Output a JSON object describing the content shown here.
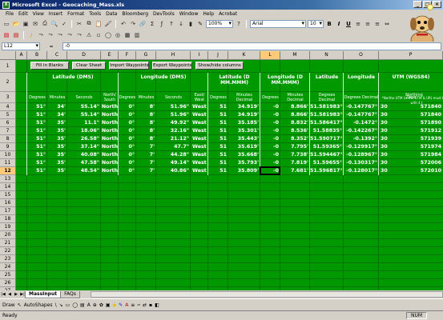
{
  "window": {
    "title": "Microsoft Excel - Geocaching_Mass.xls",
    "minimize": "_",
    "restore": "□",
    "close": "×"
  },
  "menu": [
    "File",
    "Edit",
    "View",
    "Insert",
    "Format",
    "Tools",
    "Data",
    "Bloomberg",
    "DevTools",
    "Window",
    "Help",
    "Acrobat"
  ],
  "toolbar": {
    "zoom": "100%",
    "font": "Arial",
    "size": "10",
    "bold": "B",
    "italic": "I",
    "underline": "U"
  },
  "formula": {
    "cell_ref": "L12",
    "fx": "=",
    "content": "-0"
  },
  "columns": [
    "A",
    "B",
    "C",
    "D",
    "E",
    "F",
    "G",
    "H",
    "I",
    "J",
    "K",
    "L",
    "M",
    "N",
    "O",
    "P"
  ],
  "rows": [
    "1",
    "2",
    "3",
    "4",
    "5",
    "6",
    "7",
    "8",
    "9",
    "10",
    "11",
    "12",
    "13",
    "14",
    "15",
    "16",
    "17",
    "18",
    "19",
    "20",
    "21",
    "22",
    "23",
    "24",
    "25",
    "26",
    "27"
  ],
  "buttons": {
    "fill": "Fill in Blanks",
    "clear": "Clear Sheet",
    "import": "Import Waypoints",
    "export": "Export Waypoints",
    "show": "Show/hide columns"
  },
  "headers": {
    "lat_dms": "Latitude (DMS)",
    "lon_dms": "Longitude (DMS)",
    "lat_dmm": "Latitude (D MM.MMM)",
    "lon_dmm": "Longitude (D MM.MMM)",
    "lat_dd": "Latitude",
    "lon_dd": "Longitude",
    "utm": "UTM (WGS84)",
    "degrees": "Degrees",
    "minutes": "Minutes",
    "seconds": "Seconds",
    "ns": "North/ South",
    "ew": "East/ West",
    "min_dec": "Minutes Decimal",
    "deg_dec": "Degrees Decimal",
    "zone": "Zone",
    "northing": "Northing",
    "northing_note": "*Northe UTM (is the UTM & UR) must begin with 4 t"
  },
  "data_rows": [
    {
      "latd": "51°",
      "latm": "34'",
      "lats": "55.14\"",
      "ns": "North",
      "lond": "0°",
      "lonm": "8'",
      "lons": "51.96\"",
      "ew": "West",
      "dmm_latd": "51",
      "dmm_latm": "34.919'",
      "dmm_lond": "-0",
      "dmm_lonm": "8.866'",
      "dd_lat": "51.581983°",
      "dd_lon": "-0.147767°",
      "zone": "30",
      "north": "571840"
    },
    {
      "latd": "51°",
      "latm": "34'",
      "lats": "55.14\"",
      "ns": "North",
      "lond": "0°",
      "lonm": "8'",
      "lons": "51.96\"",
      "ew": "West",
      "dmm_latd": "51",
      "dmm_latm": "34.919'",
      "dmm_lond": "-0",
      "dmm_lonm": "8.866'",
      "dd_lat": "51.581983°",
      "dd_lon": "-0.147767°",
      "zone": "30",
      "north": "571840"
    },
    {
      "latd": "51°",
      "latm": "35'",
      "lats": "11.1\"",
      "ns": "North",
      "lond": "0°",
      "lonm": "8'",
      "lons": "49.92\"",
      "ew": "West",
      "dmm_latd": "51",
      "dmm_latm": "35.185'",
      "dmm_lond": "-0",
      "dmm_lonm": "8.832'",
      "dd_lat": "51.586417°",
      "dd_lon": "-0.1472°",
      "zone": "30",
      "north": "571890"
    },
    {
      "latd": "51°",
      "latm": "35'",
      "lats": "18.06\"",
      "ns": "North",
      "lond": "0°",
      "lonm": "8'",
      "lons": "32.16\"",
      "ew": "West",
      "dmm_latd": "51",
      "dmm_latm": "35.301'",
      "dmm_lond": "-0",
      "dmm_lonm": "8.536'",
      "dd_lat": "51.58835°",
      "dd_lon": "-0.142267°",
      "zone": "30",
      "north": "571912"
    },
    {
      "latd": "51°",
      "latm": "35'",
      "lats": "26.58\"",
      "ns": "North",
      "lond": "0°",
      "lonm": "8'",
      "lons": "21.12\"",
      "ew": "West",
      "dmm_latd": "51",
      "dmm_latm": "35.443'",
      "dmm_lond": "-0",
      "dmm_lonm": "8.352'",
      "dd_lat": "51.590717°",
      "dd_lon": "-0.1392°",
      "zone": "30",
      "north": "571939"
    },
    {
      "latd": "51°",
      "latm": "35'",
      "lats": "37.14\"",
      "ns": "North",
      "lond": "0°",
      "lonm": "7'",
      "lons": "47.7\"",
      "ew": "West",
      "dmm_latd": "51",
      "dmm_latm": "35.619'",
      "dmm_lond": "-0",
      "dmm_lonm": "7.795'",
      "dd_lat": "51.59365°",
      "dd_lon": "-0.129917°",
      "zone": "30",
      "north": "571974"
    },
    {
      "latd": "51°",
      "latm": "35'",
      "lats": "40.08\"",
      "ns": "North",
      "lond": "0°",
      "lonm": "7'",
      "lons": "44.28\"",
      "ew": "West",
      "dmm_latd": "51",
      "dmm_latm": "35.668'",
      "dmm_lond": "-0",
      "dmm_lonm": "7.738'",
      "dd_lat": "51.594467°",
      "dd_lon": "-0.128967°",
      "zone": "30",
      "north": "571984"
    },
    {
      "latd": "51°",
      "latm": "35'",
      "lats": "47.58\"",
      "ns": "North",
      "lond": "0°",
      "lonm": "7'",
      "lons": "49.14\"",
      "ew": "West",
      "dmm_latd": "51",
      "dmm_latm": "35.793'",
      "dmm_lond": "-0",
      "dmm_lonm": "7.819'",
      "dd_lat": "51.59655°",
      "dd_lon": "-0.130317°",
      "zone": "30",
      "north": "572006"
    },
    {
      "latd": "51°",
      "latm": "35'",
      "lats": "48.54\"",
      "ns": "North",
      "lond": "0°",
      "lonm": "7'",
      "lons": "40.86\"",
      "ew": "West",
      "dmm_latd": "51",
      "dmm_latm": "35.809'",
      "dmm_lond": "-0",
      "dmm_lonm": "7.681'",
      "dd_lat": "51.596817°",
      "dd_lon": "-0.128017°",
      "zone": "30",
      "north": "572010"
    }
  ],
  "tabs": [
    "MassInput",
    "FAQs"
  ],
  "draw": {
    "draw_label": "Draw",
    "autoshapes": "AutoShapes"
  },
  "status": {
    "ready": "Ready",
    "num": "NUM"
  },
  "colors": {
    "sheet_green": "#009a00",
    "title_blue": "#0a246a"
  }
}
